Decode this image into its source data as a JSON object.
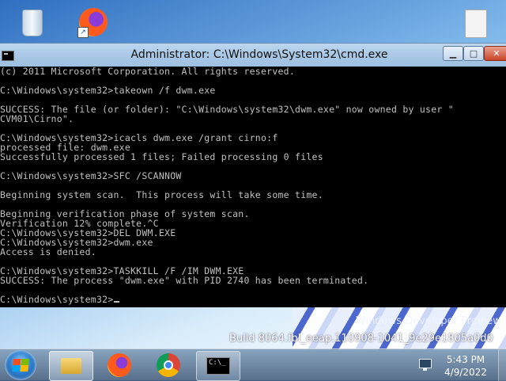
{
  "window": {
    "title": "Administrator: C:\\Windows\\System32\\cmd.exe",
    "minimize_glyph": "▁",
    "maximize_glyph": "□",
    "close_glyph": "✕"
  },
  "console": {
    "lines": [
      "(c) 2011 Microsoft Corporation. All rights reserved.",
      "",
      "C:\\Windows\\system32>takeown /f dwm.exe",
      "",
      "SUCCESS: The file (or folder): \"C:\\Windows\\system32\\dwm.exe\" now owned by user \"",
      "CVM01\\Cirno\".",
      "",
      "C:\\Windows\\system32>icacls dwm.exe /grant cirno:f",
      "processed file: dwm.exe",
      "Successfully processed 1 files; Failed processing 0 files",
      "",
      "C:\\Windows\\system32>SFC /SCANNOW",
      "",
      "Beginning system scan.  This process will take some time.",
      "",
      "Beginning verification phase of system scan.",
      "Verification 12% complete.^C",
      "C:\\Windows\\system32>DEL DWM.EXE",
      "C:\\Windows\\system32>dwm.exe",
      "Access is denied.",
      "",
      "C:\\Windows\\system32>TASKKILL /F /IM DWM.EXE",
      "SUCCESS: The process \"dwm.exe\" with PID 2740 has been terminated.",
      "",
      "C:\\Windows\\system32>"
    ]
  },
  "desktop": {
    "watermark": "Windows Developer Preview",
    "build": "Build 8064.fbl_eeap.110908-1041_9e29e1805a0d0"
  },
  "taskbar": {
    "cmd_preview": "C:\\_",
    "time": "5:43 PM",
    "date": "4/9/2022"
  },
  "icons": {
    "desktop": [
      "recycle-bin-icon",
      "firefox-icon",
      "document-icon"
    ],
    "taskbar": [
      "start-icon",
      "explorer-icon",
      "firefox-icon",
      "chrome-icon",
      "cmd-icon",
      "network-icon"
    ]
  }
}
